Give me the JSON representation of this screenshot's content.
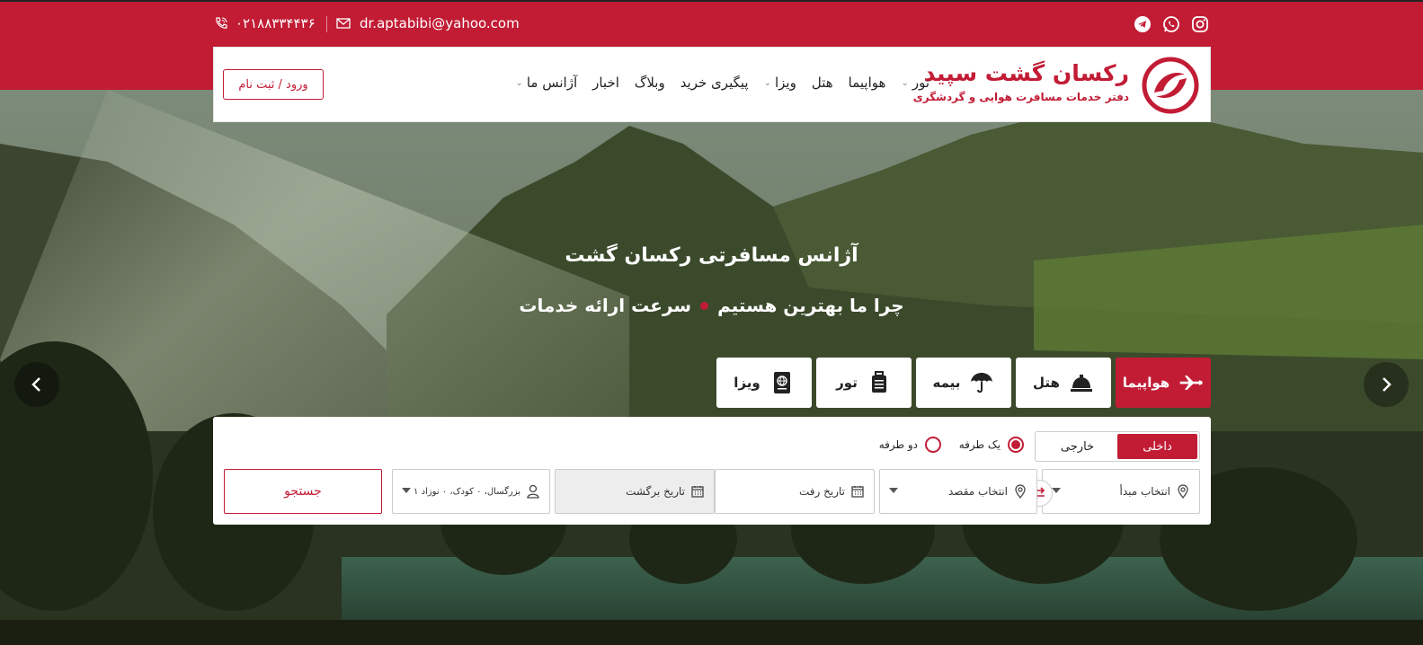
{
  "topbar": {
    "phone": "۰۲۱۸۸۳۳۴۴۳۶",
    "email": "dr.aptabibi@yahoo.com",
    "social_icons": [
      "instagram-icon",
      "whatsapp-icon",
      "telegram-icon"
    ]
  },
  "header": {
    "logo_title": "رکسان گشت سپید",
    "logo_subtitle": "دفتر خدمات مسافرت هوایی و گردشگری",
    "nav": [
      {
        "label": "تور",
        "has_dropdown": true
      },
      {
        "label": "هواپیما",
        "has_dropdown": false
      },
      {
        "label": "هتل",
        "has_dropdown": false
      },
      {
        "label": "ویزا",
        "has_dropdown": true
      },
      {
        "label": "پیگیری خرید",
        "has_dropdown": false
      },
      {
        "label": "وبلاگ",
        "has_dropdown": false
      },
      {
        "label": "اخبار",
        "has_dropdown": false
      },
      {
        "label": "آژانس ما",
        "has_dropdown": true
      }
    ],
    "login_label": "ورود / ثبت نام"
  },
  "hero": {
    "title": "آژانس مسافرتی رکسان گشت",
    "sub_left": "چرا ما بهترین هستیم",
    "sub_right": "سرعت ارائه خدمات"
  },
  "tabs": [
    {
      "label": "هواپیما",
      "icon": "airplane-icon",
      "active": true
    },
    {
      "label": "هتل",
      "icon": "hotel-bell-icon",
      "active": false
    },
    {
      "label": "بیمه",
      "icon": "umbrella-icon",
      "active": false
    },
    {
      "label": "تور",
      "icon": "suitcase-icon",
      "active": false
    },
    {
      "label": "ویزا",
      "icon": "passport-icon",
      "active": false
    }
  ],
  "search": {
    "segment": {
      "domestic": "داخلی",
      "international": "خارجی",
      "selected": "domestic"
    },
    "trip_type": {
      "one_way": "یک طرفه",
      "round_trip": "دو طرفه",
      "selected": "one_way"
    },
    "origin_placeholder": "انتخاب مبدأ",
    "destination_placeholder": "انتخاب مقصد",
    "depart_placeholder": "تاریخ رفت",
    "return_placeholder": "تاریخ برگشت",
    "passengers": "۱ بزرگسال، ۰ کودک، ۰ نوزاد",
    "submit_label": "جستجو"
  },
  "colors": {
    "brand": "#c21c35",
    "panel_bg": "#ffffff"
  }
}
